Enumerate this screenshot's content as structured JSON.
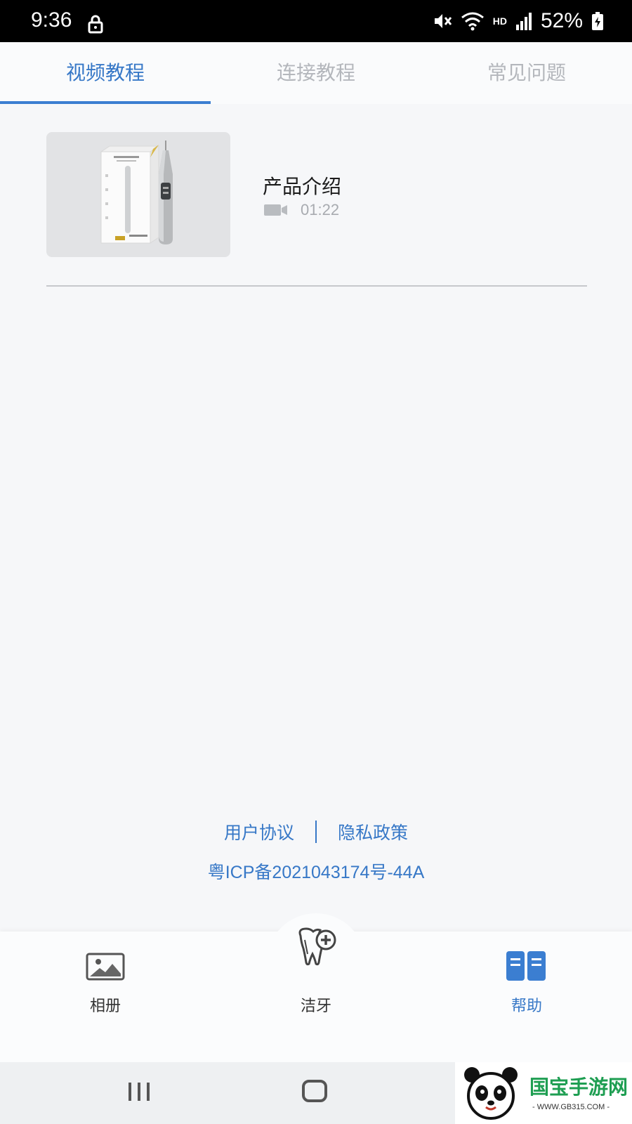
{
  "status_bar": {
    "time": "9:36",
    "network": "HD",
    "battery": "52%"
  },
  "tabs": [
    {
      "label": "视频教程",
      "active": true
    },
    {
      "label": "连接教程",
      "active": false
    },
    {
      "label": "常见问题",
      "active": false
    }
  ],
  "videos": [
    {
      "title": "产品介绍",
      "duration": "01:22",
      "thumbnail_icon": "electric-toothbrush-product-image"
    }
  ],
  "footer": {
    "user_agreement": "用户协议",
    "privacy_policy": "隐私政策",
    "icp": "粤ICP备2021043174号-44A"
  },
  "bottom_nav": [
    {
      "label": "相册",
      "icon": "album-icon",
      "active": false
    },
    {
      "label": "洁牙",
      "icon": "tooth-clean-icon",
      "active": false
    },
    {
      "label": "帮助",
      "icon": "help-book-icon",
      "active": true
    }
  ],
  "colors": {
    "accent": "#3778c7",
    "inactive_tab": "#b4b7bc",
    "background": "#f6f7f9"
  },
  "watermark": {
    "brand": "国宝手游网",
    "url": "- WWW.GB315.COM -"
  }
}
